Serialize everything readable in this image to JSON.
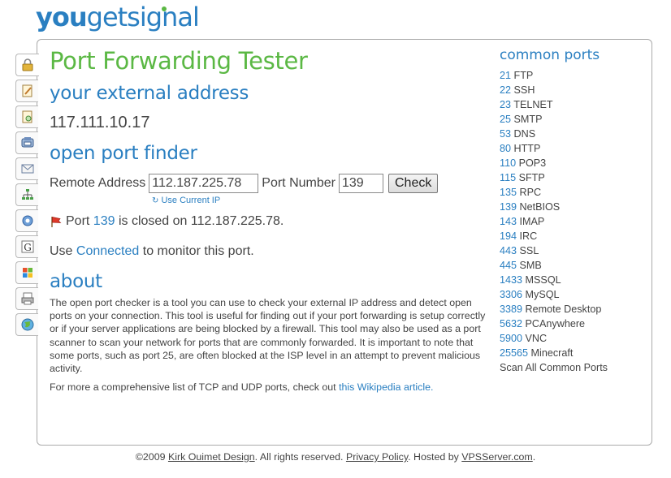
{
  "logo": {
    "part1": "you",
    "part2": "get",
    "part3": "signal"
  },
  "tabs": [
    {
      "icon": "lock-icon"
    },
    {
      "icon": "document-pencil-icon"
    },
    {
      "icon": "document-search-icon"
    },
    {
      "icon": "phone-icon"
    },
    {
      "icon": "envelope-icon"
    },
    {
      "icon": "network-tree-icon"
    },
    {
      "icon": "magnifier-globe-icon"
    },
    {
      "icon": "google-g-icon"
    },
    {
      "icon": "windows-icon"
    },
    {
      "icon": "printer-icon"
    },
    {
      "icon": "globe-icon"
    }
  ],
  "main": {
    "title": "Port Forwarding Tester",
    "external_heading": "your external address",
    "external_ip": "117.111.10.17",
    "finder_heading": "open port finder",
    "remote_label": "Remote Address",
    "remote_value": "112.187.225.78",
    "port_label": "Port Number",
    "port_value": "139",
    "check_label": "Check",
    "use_current_ip": "Use Current IP",
    "result_prefix": "Port",
    "result_port": "139",
    "result_suffix": "is closed on 112.187.225.78.",
    "monitor_prefix": "Use",
    "monitor_link": "Connected",
    "monitor_suffix": "to monitor this port.",
    "about_heading": "about",
    "about_text": "The open port checker is a tool you can use to check your external IP address and detect open ports on your connection. This tool is useful for finding out if your port forwarding is setup correctly or if your server applications are being blocked by a firewall. This tool may also be used as a port scanner to scan your network for ports that are commonly forwarded. It is important to note that some ports, such as port 25, are often blocked at the ISP level in an attempt to prevent malicious activity.",
    "more_prefix": "For more a comprehensive list of TCP and UDP ports, check out",
    "more_link": "this Wikipedia article."
  },
  "side": {
    "heading": "common ports",
    "ports": [
      {
        "num": "21",
        "name": "FTP"
      },
      {
        "num": "22",
        "name": "SSH"
      },
      {
        "num": "23",
        "name": "TELNET"
      },
      {
        "num": "25",
        "name": "SMTP"
      },
      {
        "num": "53",
        "name": "DNS"
      },
      {
        "num": "80",
        "name": "HTTP"
      },
      {
        "num": "110",
        "name": "POP3"
      },
      {
        "num": "115",
        "name": "SFTP"
      },
      {
        "num": "135",
        "name": "RPC"
      },
      {
        "num": "139",
        "name": "NetBIOS"
      },
      {
        "num": "143",
        "name": "IMAP"
      },
      {
        "num": "194",
        "name": "IRC"
      },
      {
        "num": "443",
        "name": "SSL"
      },
      {
        "num": "445",
        "name": "SMB"
      },
      {
        "num": "1433",
        "name": "MSSQL"
      },
      {
        "num": "3306",
        "name": "MySQL"
      },
      {
        "num": "3389",
        "name": "Remote Desktop"
      },
      {
        "num": "5632",
        "name": "PCAnywhere"
      },
      {
        "num": "5900",
        "name": "VNC"
      },
      {
        "num": "25565",
        "name": "Minecraft"
      }
    ],
    "scan_all": "Scan All Common Ports"
  },
  "footer": {
    "copy": "©2009",
    "author_link": "Kirk Ouimet Design",
    "rights": ". All rights reserved.",
    "privacy_link": "Privacy Policy",
    "hosted": ". Hosted by",
    "host_link": "VPSServer.com",
    "end": "."
  },
  "colors": {
    "title_green": "#5bb844",
    "accent_blue": "#2a7fc1",
    "text": "#444444"
  }
}
